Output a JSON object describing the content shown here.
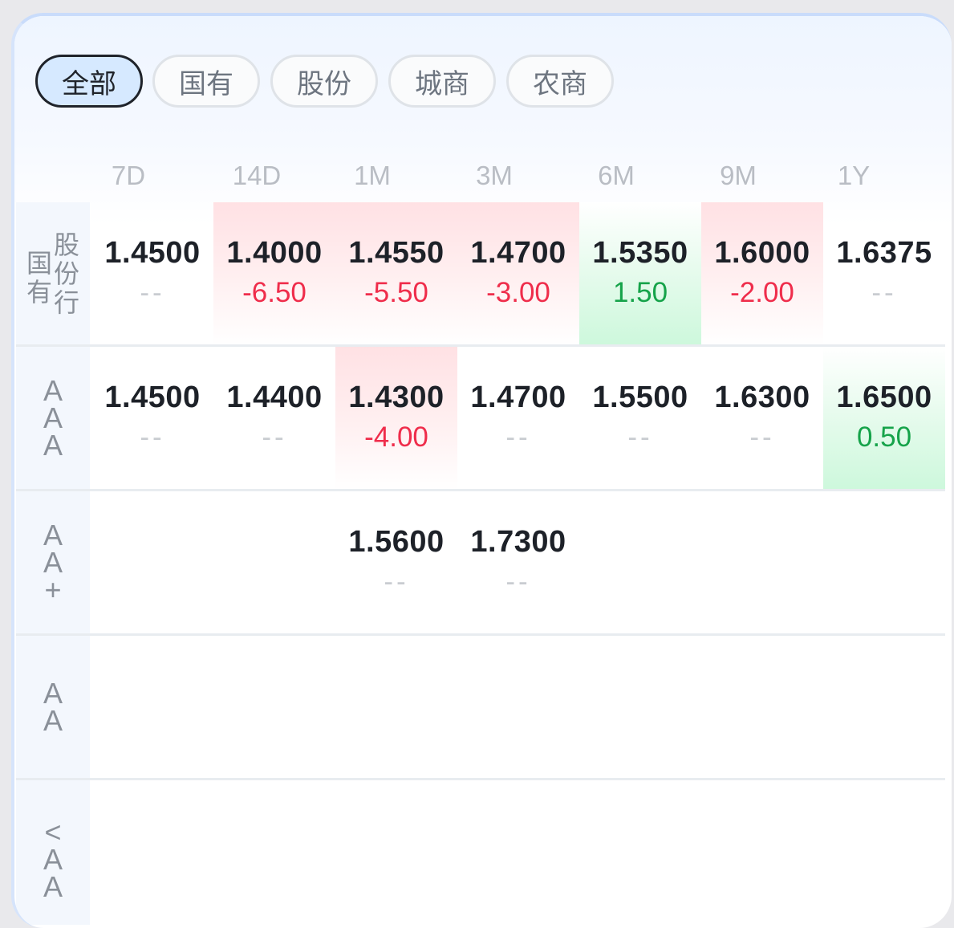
{
  "tabs": [
    {
      "label": "全部",
      "active": true
    },
    {
      "label": "国有",
      "active": false
    },
    {
      "label": "股份",
      "active": false
    },
    {
      "label": "城商",
      "active": false
    },
    {
      "label": "农商",
      "active": false
    }
  ],
  "columns": [
    "7D",
    "14D",
    "1M",
    "3M",
    "6M",
    "9M",
    "1Y"
  ],
  "rows": [
    {
      "label": "国有股份行",
      "label_cols": [
        [
          "国",
          "有"
        ],
        [
          "股",
          "份",
          "行"
        ]
      ],
      "cells": [
        {
          "value": "1.4500",
          "change": "--",
          "trend": "none"
        },
        {
          "value": "1.4000",
          "change": "-6.50",
          "trend": "down"
        },
        {
          "value": "1.4550",
          "change": "-5.50",
          "trend": "down"
        },
        {
          "value": "1.4700",
          "change": "-3.00",
          "trend": "down"
        },
        {
          "value": "1.5350",
          "change": "1.50",
          "trend": "up"
        },
        {
          "value": "1.6000",
          "change": "-2.00",
          "trend": "down"
        },
        {
          "value": "1.6375",
          "change": "--",
          "trend": "none"
        }
      ]
    },
    {
      "label": "AAA",
      "label_chars": [
        "A",
        "A",
        "A"
      ],
      "cells": [
        {
          "value": "1.4500",
          "change": "--",
          "trend": "none"
        },
        {
          "value": "1.4400",
          "change": "--",
          "trend": "none"
        },
        {
          "value": "1.4300",
          "change": "-4.00",
          "trend": "down"
        },
        {
          "value": "1.4700",
          "change": "--",
          "trend": "none"
        },
        {
          "value": "1.5500",
          "change": "--",
          "trend": "none"
        },
        {
          "value": "1.6300",
          "change": "--",
          "trend": "none"
        },
        {
          "value": "1.6500",
          "change": "0.50",
          "trend": "up"
        }
      ]
    },
    {
      "label": "AA+",
      "label_chars": [
        "A",
        "A",
        "+"
      ],
      "cells": [
        null,
        null,
        {
          "value": "1.5600",
          "change": "--",
          "trend": "none"
        },
        {
          "value": "1.7300",
          "change": "--",
          "trend": "none"
        },
        null,
        null,
        null
      ]
    },
    {
      "label": "AA",
      "label_chars": [
        "A",
        "A"
      ],
      "cells": [
        null,
        null,
        null,
        null,
        null,
        null,
        null
      ]
    },
    {
      "label": "<AA",
      "label_chars": [
        "<",
        "A",
        "A"
      ],
      "cells": [
        null,
        null,
        null,
        null,
        null,
        null,
        null
      ]
    }
  ],
  "colors": {
    "negative": "#ef2d4b",
    "positive": "#16a34a",
    "active_tab_bg": "#d6e9ff"
  },
  "icons": []
}
